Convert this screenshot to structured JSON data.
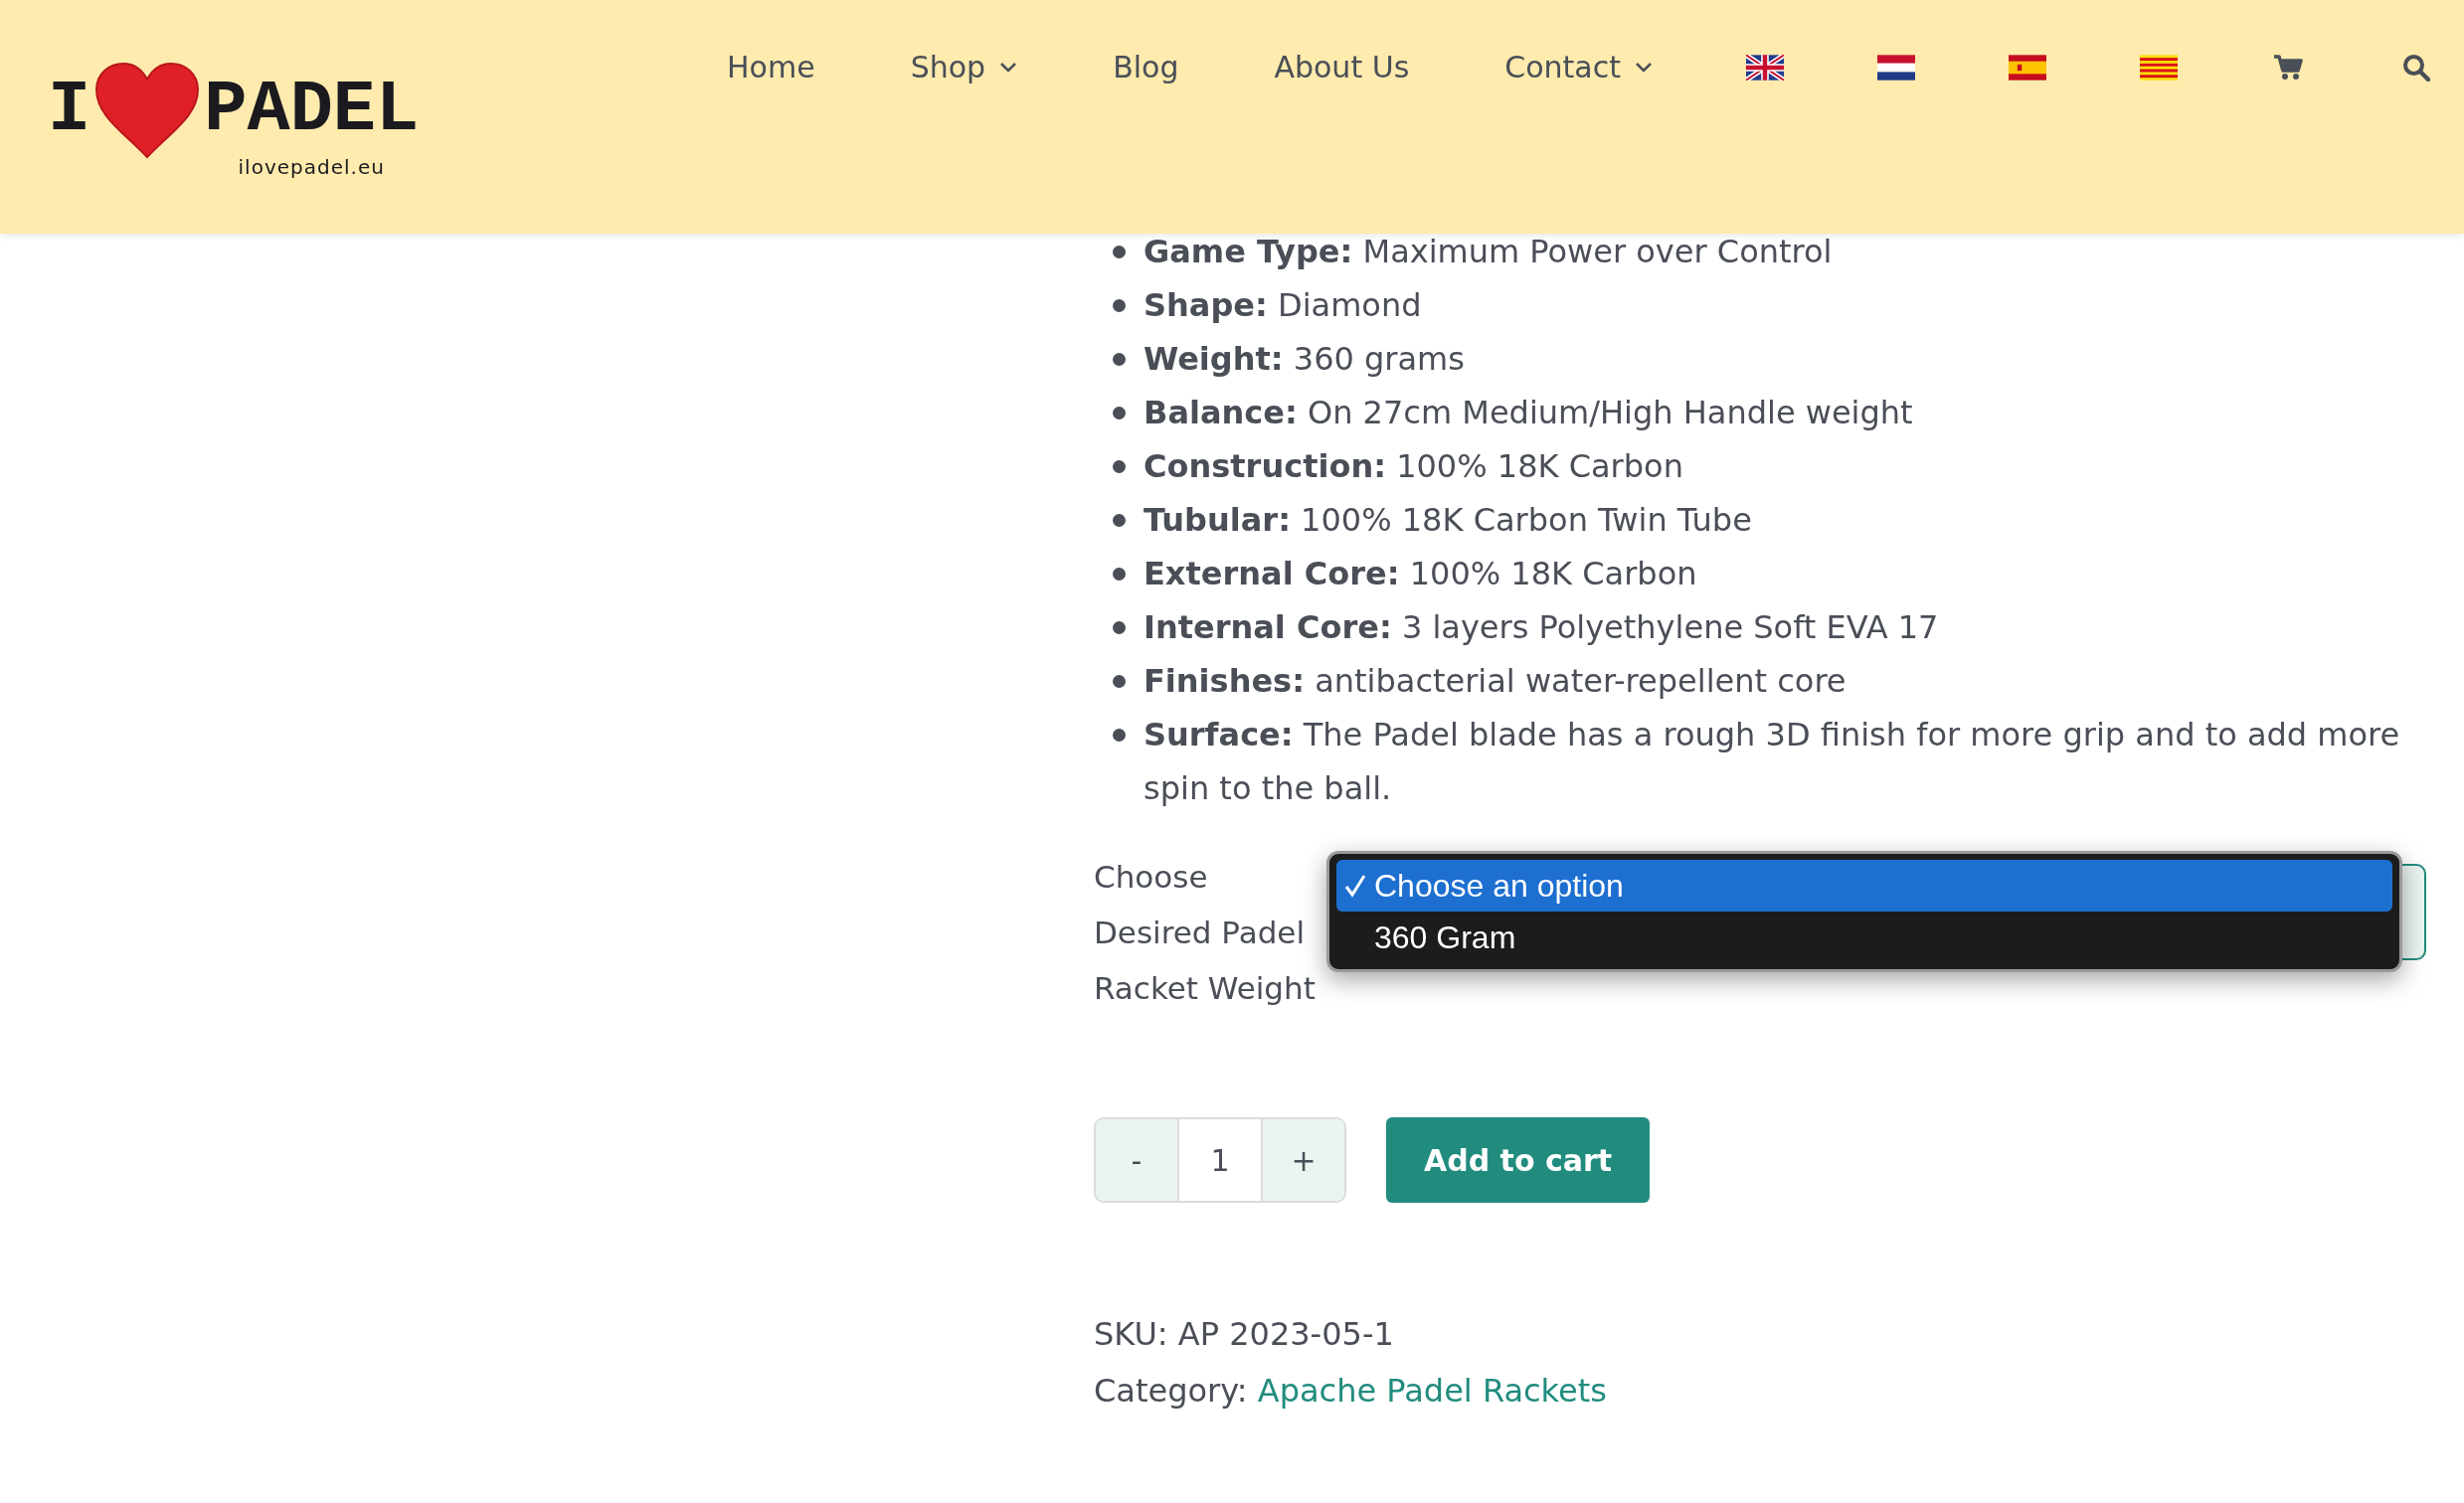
{
  "header": {
    "logo": {
      "word_i": "I",
      "word_padel": "PADEL",
      "domain": "ilovepadel.eu"
    },
    "nav": [
      {
        "label": "Home",
        "has_menu": false
      },
      {
        "label": "Shop",
        "has_menu": true
      },
      {
        "label": "Blog",
        "has_menu": false
      },
      {
        "label": "About Us",
        "has_menu": false
      },
      {
        "label": "Contact",
        "has_menu": true
      }
    ],
    "languages": [
      {
        "kind": "uk"
      },
      {
        "kind": "nl"
      },
      {
        "kind": "es"
      },
      {
        "kind": "ca"
      }
    ]
  },
  "specs": [
    "**Game Type:** Maximum Power over Control",
    "**Shape:** Diamond",
    "**Weight:** 360 grams",
    "**Balance:** On 27cm Medium/High Handle weight",
    "**Construction:** 100% 18K Carbon",
    "**Tubular:** 100% 18K Carbon Twin Tube",
    "**External Core:** 100% 18K Carbon",
    "**Internal Core:** 3 layers Polyethylene Soft EVA 17",
    "**Finishes:** antibacterial water-repellent core",
    "**Surface:** The Padel blade has a rough 3D finish for more grip and to add more spin to the ball."
  ],
  "variation": {
    "label": "Choose Desired Padel Racket Weight",
    "options": [
      {
        "label": "Choose an option",
        "selected": true
      },
      {
        "label": "360 Gram",
        "selected": false
      }
    ]
  },
  "quantity": {
    "minus": "-",
    "value": "1",
    "plus": "+"
  },
  "add_to_cart": "Add to cart",
  "meta": {
    "sku": "SKU: AP 2023-05-1",
    "category_label": "Category:",
    "category_link": "Apache Padel Rackets"
  }
}
